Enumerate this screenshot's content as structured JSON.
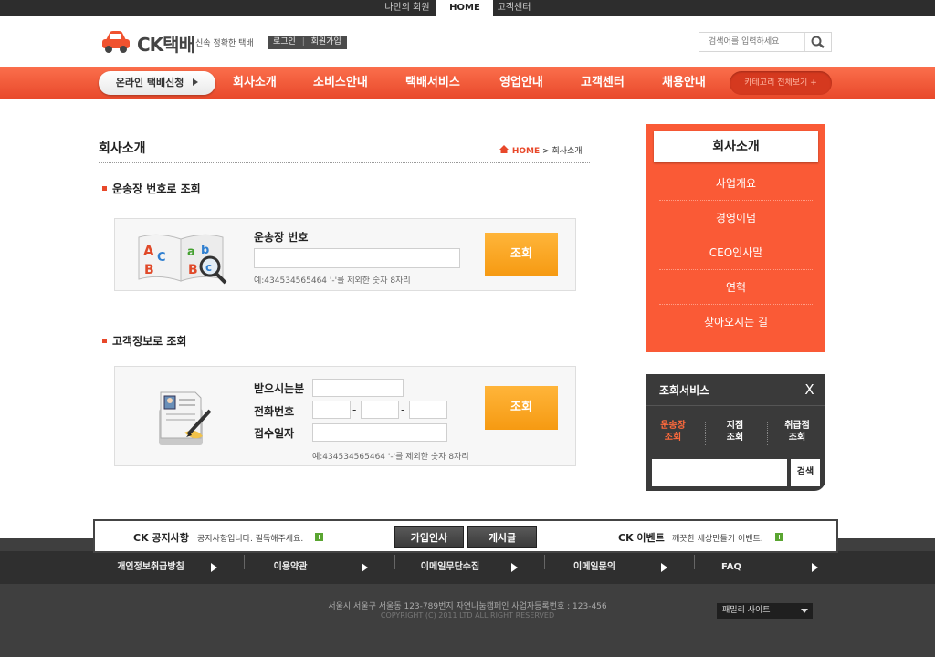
{
  "topbar": {
    "my_page": "나만의 회원",
    "home": "HOME",
    "support": "고객센터"
  },
  "header": {
    "logo": "CK택배",
    "slogan": "신속 정확한 택배",
    "login": "로그인",
    "signup": "회원가입",
    "search_placeholder": "검색어를 입력하세요"
  },
  "nav": {
    "apply": "온라인 택배신청",
    "items": [
      "회사소개",
      "소비스안내",
      "택배서비스",
      "영업안내",
      "고객센터",
      "채용안내"
    ],
    "all_categories": "카테고리 전체보기 +"
  },
  "page": {
    "title": "회사소개",
    "breadcrumb_home": "HOME",
    "breadcrumb_sep": ">",
    "breadcrumb_current": "회사소개"
  },
  "waybill": {
    "section": "운송장 번호로 조회",
    "label": "운송장 번호",
    "hint": "예:434534565464 '-'를 제외한 숫자 8자리",
    "button": "조회"
  },
  "customer": {
    "section": "고객정보로 조회",
    "receiver_label": "받으시는분",
    "phone_label": "전화번호",
    "date_label": "접수일자",
    "dash": "-",
    "hint": "예:434534565464 '-'를 제외한 숫자 8자리",
    "button": "조회"
  },
  "sidebar": {
    "title": "회사소개",
    "items": [
      "사업개요",
      "경영이념",
      "CEO인사말",
      "연혁",
      "찾아오시는 길"
    ]
  },
  "quick_service": {
    "title": "조회서비스",
    "close": "X",
    "tabs": [
      {
        "line1": "운송장",
        "line2": "조회"
      },
      {
        "line1": "지점",
        "line2": "조회"
      },
      {
        "line1": "취급점",
        "line2": "조회"
      }
    ],
    "search_button": "검색"
  },
  "notice": {
    "notice_label": "CK 공지사항",
    "notice_text": "공지사항입니다. 필독해주세요.",
    "plus": "+",
    "btn_join": "가입인사",
    "btn_board": "게시글",
    "event_label": "CK 이벤트",
    "event_text": "깨끗한 세상만들기 이벤트."
  },
  "footer": {
    "links": [
      "개인정보취급방침",
      "이용약관",
      "이메일무단수집",
      "이메일문의",
      "FAQ"
    ],
    "address": "서울시 서울구 서울동 123-789번지 자연나눔캠페인 사업자등록번호 : 123-456",
    "copyright": "COPYRIGHT (C) 2011 LTD ALL RIGHT RESERVED",
    "family_site": "패밀리 사이트"
  },
  "colors": {
    "accent": "#f0522f",
    "button_yellow": "#f9a521",
    "dark": "#3a3a3a"
  }
}
